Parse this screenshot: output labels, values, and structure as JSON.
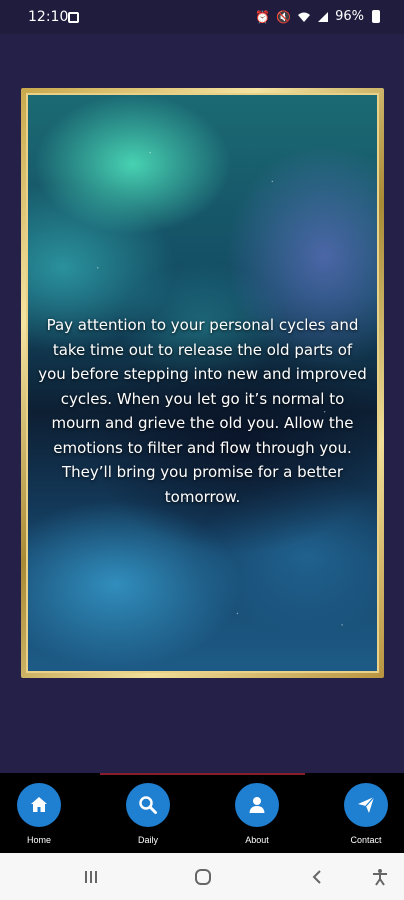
{
  "status_bar": {
    "time": "12:10",
    "battery": "96%"
  },
  "card": {
    "message": "Pay attention to your personal cycles and take time out to release the old parts of you before stepping into new and improved cycles. When you let go it’s normal to mourn and grieve the old you. Allow the emotions to filter and flow through you. They’ll bring you promise for a better tomorrow."
  },
  "bottom_nav": {
    "items": [
      {
        "label": "Home",
        "icon": "home-icon"
      },
      {
        "label": "Daily",
        "icon": "search-icon"
      },
      {
        "label": "About",
        "icon": "user-icon"
      },
      {
        "label": "Contact",
        "icon": "send-icon"
      }
    ]
  },
  "colors": {
    "background": "#242047",
    "nav_button": "#1f7fd1",
    "frame_gold": "#c9a84c"
  }
}
